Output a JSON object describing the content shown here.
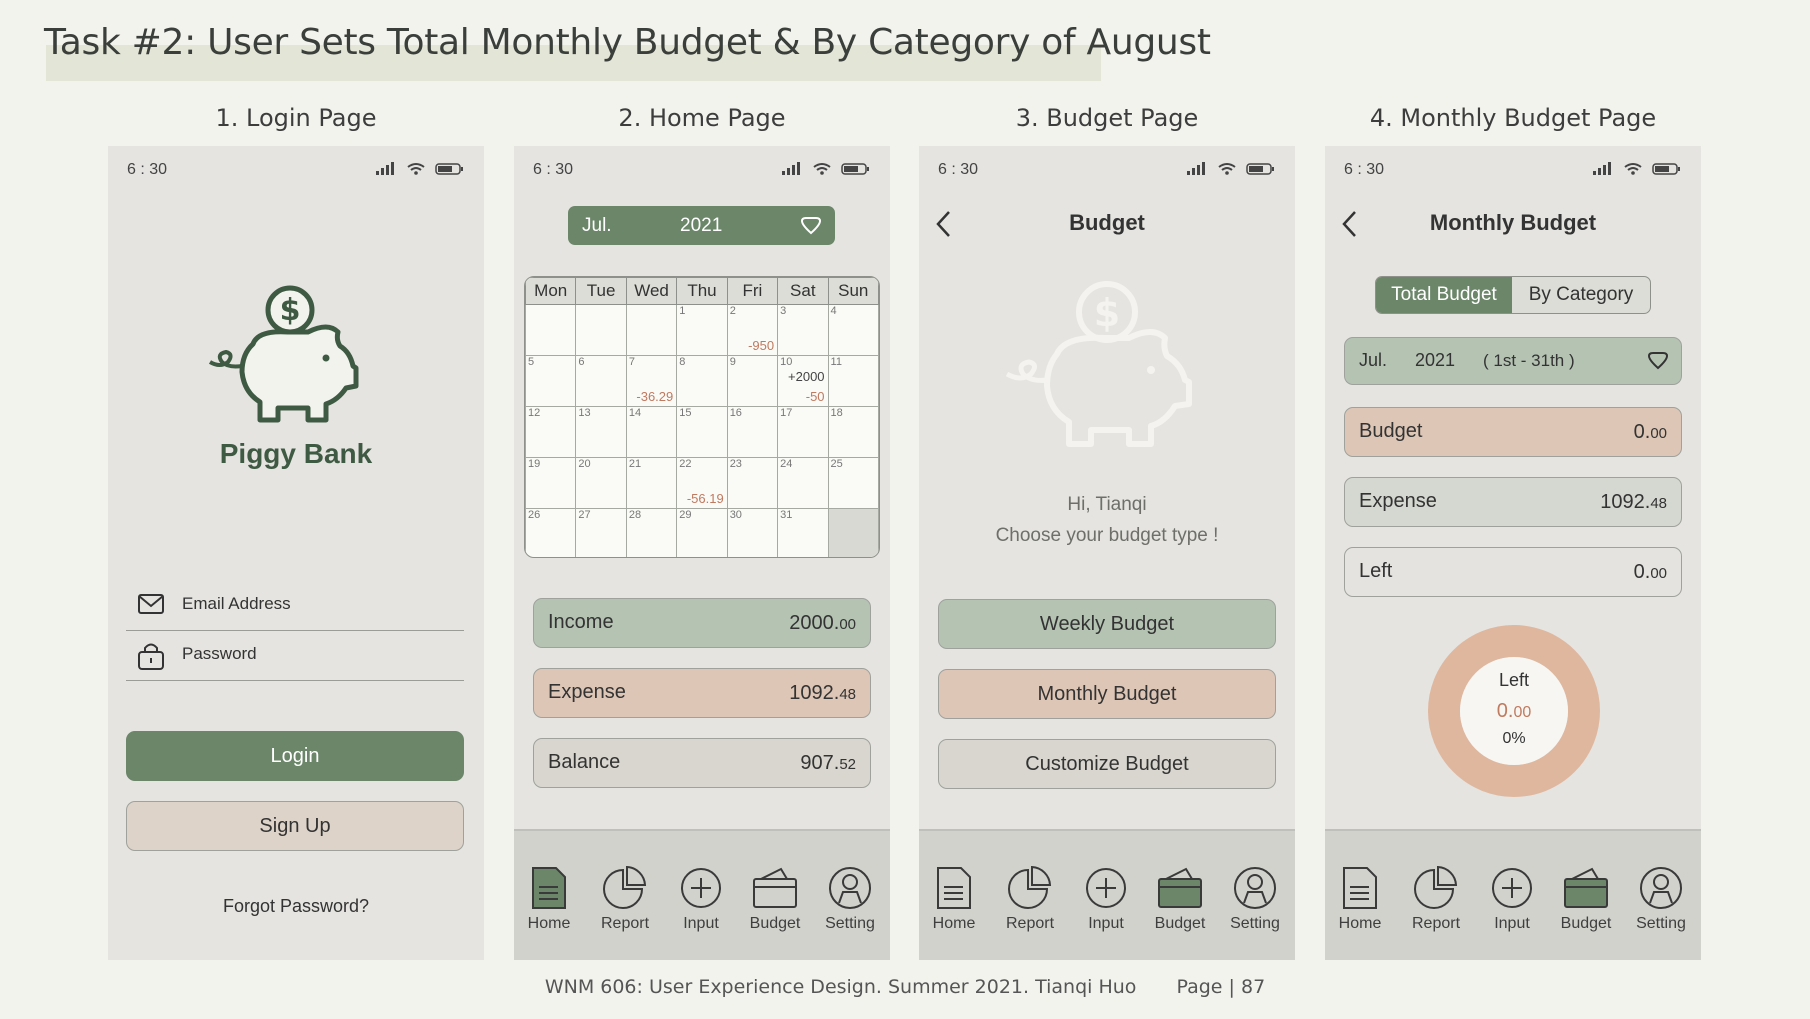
{
  "header": {
    "title": "Task #2: User Sets Total Monthly Budget & By Category of August"
  },
  "columns": [
    {
      "title": "1. Login Page"
    },
    {
      "title": "2. Home Page"
    },
    {
      "title": "3. Budget Page"
    },
    {
      "title": "4. Monthly Budget Page"
    }
  ],
  "status": {
    "time": "6 : 30"
  },
  "login": {
    "app_name": "Piggy Bank",
    "email_label": "Email Address",
    "password_label": "Password",
    "login_button": "Login",
    "signup_button": "Sign Up",
    "forgot_link": "Forgot Password?"
  },
  "home": {
    "month": "Jul.",
    "year": "2021",
    "weekdays": [
      "Mon",
      "Tue",
      "Wed",
      "Thu",
      "Fri",
      "Sat",
      "Sun"
    ],
    "weeks": [
      [
        {
          "d": ""
        },
        {
          "d": ""
        },
        {
          "d": ""
        },
        {
          "d": "1"
        },
        {
          "d": "2",
          "n": "-950"
        },
        {
          "d": "3"
        },
        {
          "d": "4"
        }
      ],
      [
        {
          "d": "5"
        },
        {
          "d": "6"
        },
        {
          "d": "7",
          "n": "-36.29"
        },
        {
          "d": "8"
        },
        {
          "d": "9"
        },
        {
          "d": "10",
          "t": "+2000",
          "n": "-50"
        },
        {
          "d": "11"
        }
      ],
      [
        {
          "d": "12"
        },
        {
          "d": "13"
        },
        {
          "d": "14"
        },
        {
          "d": "15"
        },
        {
          "d": "16"
        },
        {
          "d": "17"
        },
        {
          "d": "18"
        }
      ],
      [
        {
          "d": "19"
        },
        {
          "d": "20"
        },
        {
          "d": "21"
        },
        {
          "d": "22",
          "n": "-56.19"
        },
        {
          "d": "23"
        },
        {
          "d": "24"
        },
        {
          "d": "25"
        }
      ],
      [
        {
          "d": "26"
        },
        {
          "d": "27"
        },
        {
          "d": "28"
        },
        {
          "d": "29"
        },
        {
          "d": "30"
        },
        {
          "d": "31"
        },
        {
          "d": "",
          "empty": true
        }
      ]
    ],
    "income_label": "Income",
    "income_int": "2000.",
    "income_dec": "00",
    "expense_label": "Expense",
    "expense_int": "1092.",
    "expense_dec": "48",
    "balance_label": "Balance",
    "balance_int": "907.",
    "balance_dec": "52"
  },
  "budget": {
    "title": "Budget",
    "greeting": "Hi, Tianqi",
    "prompt": "Choose your budget type !",
    "weekly": "Weekly Budget",
    "monthly": "Monthly Budget",
    "customize": "Customize Budget"
  },
  "monthly": {
    "title": "Monthly Budget",
    "tab_total": "Total Budget",
    "tab_category": "By Category",
    "month": "Jul.",
    "year": "2021",
    "range": "( 1st - 31th )",
    "budget_label": "Budget",
    "budget_int": "0.",
    "budget_dec": "00",
    "expense_label": "Expense",
    "expense_int": "1092.",
    "expense_dec": "48",
    "left_label": "Left",
    "left_int": "0.",
    "left_dec": "00",
    "donut_label": "Left",
    "donut_int": "0.",
    "donut_dec": "00",
    "donut_pct": "0%",
    "donut_fill_fraction": 0
  },
  "nav": {
    "home": "Home",
    "report": "Report",
    "input": "Input",
    "budget": "Budget",
    "setting": "Setting"
  },
  "footer": {
    "text": "WNM 606: User Experience Design. Summer 2021. Tianqi Huo",
    "page": "Page | 87"
  },
  "colors": {
    "green": "#6b8669",
    "peach": "#ddc6b6",
    "sage": "#b5c3b3",
    "gray": "#d8d6cf",
    "accent_red": "#c07a5f"
  }
}
